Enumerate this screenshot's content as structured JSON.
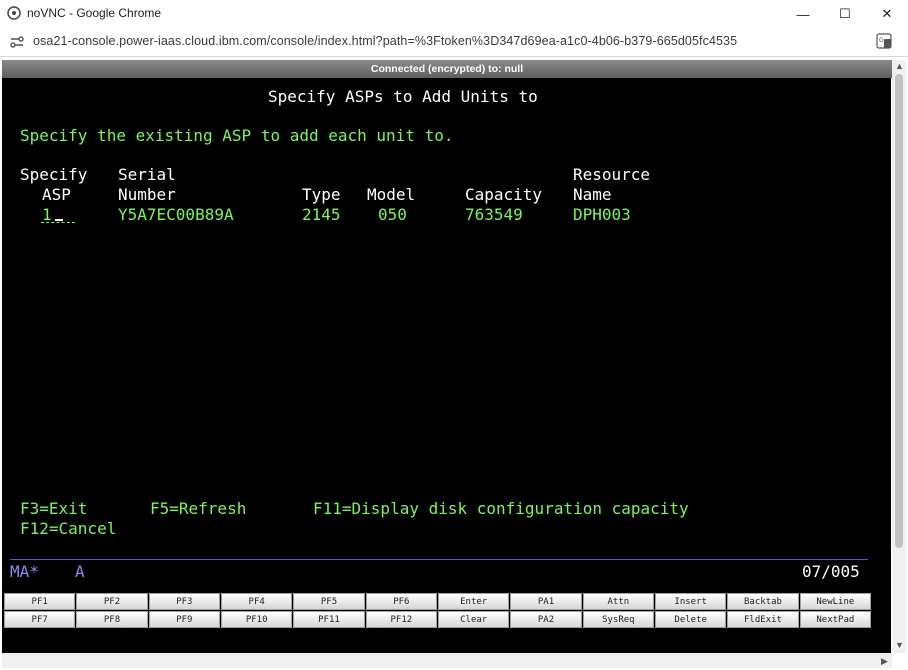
{
  "window": {
    "title": "noVNC - Google Chrome",
    "url": "osa21-console.power-iaas.cloud.ibm.com/console/index.html?path=%3Ftoken%3D347d69ea-a1c0-4b06-b379-665d05fc4535",
    "minimize": "—",
    "maximize": "☐",
    "close": "✕"
  },
  "vnc_status": "Connected (encrypted) to: null",
  "terminal": {
    "title": "Specify ASPs to Add Units to",
    "instruction": "Specify the existing ASP to add each unit to.",
    "headers": {
      "specify": "Specify",
      "asp": "ASP",
      "serial": "Serial",
      "number": "Number",
      "type": "Type",
      "model": "Model",
      "capacity": "Capacity",
      "resource": "Resource",
      "name": "Name"
    },
    "row": {
      "asp": "1",
      "serial": "Y5A7EC00B89A",
      "type": "2145",
      "model": "050",
      "capacity": "763549",
      "resource": "DPH003"
    },
    "fkeys": {
      "exit": "F3=Exit",
      "refresh": "F5=Refresh",
      "display": "F11=Display disk configuration capacity",
      "cancel": "F12=Cancel"
    },
    "status": {
      "indicator": "MA*",
      "mode": "A",
      "position": "07/005"
    }
  },
  "keypad": {
    "row1": [
      "PF1",
      "PF2",
      "PF3",
      "PF4",
      "PF5",
      "PF6",
      "Enter",
      "PA1",
      "Attn",
      "Insert",
      "Backtab",
      "NewLine"
    ],
    "row2": [
      "PF7",
      "PF8",
      "PF9",
      "PF10",
      "PF11",
      "PF12",
      "Clear",
      "PA2",
      "SysReq",
      "Delete",
      "FldExit",
      "NextPad"
    ]
  },
  "colors": {
    "screen_bg": "#000000",
    "green": "#7cf55a",
    "white": "#ffffff",
    "blue": "#8a8cf5"
  }
}
